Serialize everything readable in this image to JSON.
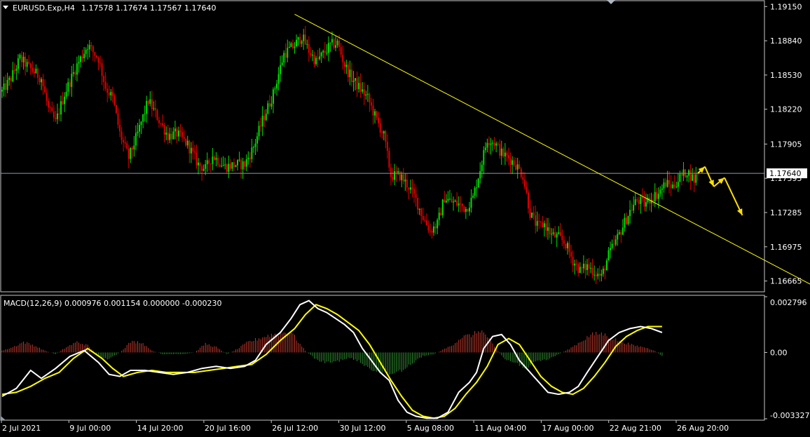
{
  "header": {
    "symbol_label": "EURUSD.Exp,H4",
    "ohlc_label": "1.17578 1.17674 1.17567 1.17640"
  },
  "colors": {
    "background": "#000000",
    "bull_candle": "#00e000",
    "bear_candle": "#e00000",
    "trendline": "#ffff00",
    "forecast_arrow": "#ffe000",
    "price_line": "#8a9bb0",
    "macd_line": "#ffffff",
    "signal_line": "#ffff00",
    "hist_positive": "#c0392b",
    "hist_negative": "#2e8b2e",
    "axis_text": "#ffffff",
    "price_tag_bg": "#ffffff",
    "price_tag_text": "#000000"
  },
  "chart_data": [
    {
      "type": "candlestick",
      "title": "EURUSD.Exp,H4",
      "y_ticks": [
        "1.19150",
        "1.18840",
        "1.18530",
        "1.18220",
        "1.17905",
        "1.17595",
        "1.17285",
        "1.16975",
        "1.16665"
      ],
      "ylim": [
        1.1658,
        1.1919
      ],
      "current_price": "1.17640",
      "x_ticks": [
        "2 Jul 2021",
        "9 Jul 00:00",
        "14 Jul 20:00",
        "20 Jul 16:00",
        "26 Jul 12:00",
        "30 Jul 12:00",
        "5 Aug 08:00",
        "11 Aug 04:00",
        "17 Aug 00:00",
        "22 Aug 21:00",
        "26 Aug 20:00"
      ],
      "close_path": [
        [
          0,
          1.1838
        ],
        [
          5,
          1.185
        ],
        [
          10,
          1.1868
        ],
        [
          15,
          1.186
        ],
        [
          22,
          1.185
        ],
        [
          26,
          1.1822
        ],
        [
          30,
          1.181
        ],
        [
          35,
          1.1836
        ],
        [
          42,
          1.1862
        ],
        [
          48,
          1.188
        ],
        [
          54,
          1.1868
        ],
        [
          58,
          1.1842
        ],
        [
          62,
          1.1832
        ],
        [
          66,
          1.18
        ],
        [
          71,
          1.1778
        ],
        [
          76,
          1.18
        ],
        [
          82,
          1.183
        ],
        [
          88,
          1.1812
        ],
        [
          93,
          1.1798
        ],
        [
          98,
          1.18
        ],
        [
          104,
          1.179
        ],
        [
          110,
          1.1772
        ],
        [
          114,
          1.1768
        ],
        [
          118,
          1.178
        ],
        [
          125,
          1.177
        ],
        [
          131,
          1.1772
        ],
        [
          136,
          1.1772
        ],
        [
          141,
          1.1788
        ],
        [
          146,
          1.1812
        ],
        [
          152,
          1.1836
        ],
        [
          158,
          1.1872
        ],
        [
          164,
          1.188
        ],
        [
          168,
          1.1888
        ],
        [
          172,
          1.1875
        ],
        [
          176,
          1.1865
        ],
        [
          180,
          1.1872
        ],
        [
          184,
          1.188
        ],
        [
          188,
          1.1882
        ],
        [
          192,
          1.1862
        ],
        [
          196,
          1.185
        ],
        [
          200,
          1.1842
        ],
        [
          205,
          1.1832
        ],
        [
          210,
          1.1812
        ],
        [
          214,
          1.1798
        ],
        [
          218,
          1.1762
        ],
        [
          223,
          1.1762
        ],
        [
          228,
          1.1752
        ],
        [
          232,
          1.174
        ],
        [
          236,
          1.1724
        ],
        [
          240,
          1.1712
        ],
        [
          244,
          1.1718
        ],
        [
          248,
          1.1742
        ],
        [
          252,
          1.1738
        ],
        [
          256,
          1.1736
        ],
        [
          260,
          1.1732
        ],
        [
          264,
          1.1742
        ],
        [
          268,
          1.1768
        ],
        [
          272,
          1.1795
        ],
        [
          276,
          1.1792
        ],
        [
          280,
          1.1782
        ],
        [
          284,
          1.1778
        ],
        [
          288,
          1.1772
        ],
        [
          292,
          1.1762
        ],
        [
          296,
          1.1728
        ],
        [
          300,
          1.1716
        ],
        [
          304,
          1.1718
        ],
        [
          308,
          1.1708
        ],
        [
          312,
          1.1706
        ],
        [
          316,
          1.17
        ],
        [
          320,
          1.1685
        ],
        [
          324,
          1.1676
        ],
        [
          328,
          1.168
        ],
        [
          332,
          1.1675
        ],
        [
          336,
          1.167
        ],
        [
          340,
          1.169
        ],
        [
          344,
          1.1702
        ],
        [
          348,
          1.1716
        ],
        [
          352,
          1.173
        ],
        [
          356,
          1.174
        ],
        [
          360,
          1.1736
        ],
        [
          364,
          1.1742
        ],
        [
          368,
          1.1746
        ],
        [
          372,
          1.1755
        ],
        [
          376,
          1.1752
        ],
        [
          380,
          1.176
        ],
        [
          384,
          1.1766
        ],
        [
          388,
          1.1758
        ],
        [
          390,
          1.1764
        ]
      ],
      "trendline": {
        "from": [
          164,
          1.1908
        ],
        "to": [
          455,
          1.1662
        ]
      },
      "forecast_path": [
        [
          390,
          1.1764
        ],
        [
          394,
          1.177
        ],
        [
          399,
          1.1752
        ],
        [
          405,
          1.176
        ],
        [
          415,
          1.1726
        ]
      ],
      "xlim": [
        0,
        427
      ]
    },
    {
      "type": "line",
      "title": "MACD(12,26,9) 0.000976 0.001154 0.000000 -0.000230",
      "y_ticks": [
        "0.002796",
        "0.00",
        "-0.003327"
      ],
      "ylim": [
        -0.003327,
        0.002796
      ],
      "series": [
        {
          "name": "MACD",
          "points": [
            [
              0,
              -0.0022
            ],
            [
              8,
              -0.0018
            ],
            [
              16,
              -0.0009
            ],
            [
              22,
              -0.0013
            ],
            [
              30,
              -0.0008
            ],
            [
              38,
              -0.0002
            ],
            [
              46,
              0.0001
            ],
            [
              54,
              -0.0005
            ],
            [
              60,
              -0.0011
            ],
            [
              66,
              -0.0012
            ],
            [
              72,
              -0.0009
            ],
            [
              80,
              -0.0009
            ],
            [
              88,
              -0.001
            ],
            [
              96,
              -0.0011
            ],
            [
              104,
              -0.001
            ],
            [
              112,
              -0.0008
            ],
            [
              120,
              -0.0007
            ],
            [
              128,
              -0.0008
            ],
            [
              136,
              -0.0007
            ],
            [
              142,
              -0.0004
            ],
            [
              148,
              0.0004
            ],
            [
              156,
              0.001
            ],
            [
              162,
              0.0017
            ],
            [
              167,
              0.0024
            ],
            [
              172,
              0.0026
            ],
            [
              177,
              0.0022
            ],
            [
              182,
              0.002
            ],
            [
              187,
              0.0017
            ],
            [
              192,
              0.0014
            ],
            [
              197,
              0.001
            ],
            [
              202,
              0.0002
            ],
            [
              207,
              -0.0004
            ],
            [
              212,
              -0.001
            ],
            [
              217,
              -0.0014
            ],
            [
              222,
              -0.0024
            ],
            [
              227,
              -0.003
            ],
            [
              232,
              -0.0032
            ],
            [
              238,
              -0.0033
            ],
            [
              244,
              -0.0033
            ],
            [
              250,
              -0.003
            ],
            [
              256,
              -0.002
            ],
            [
              262,
              -0.0015
            ],
            [
              266,
              -0.001
            ],
            [
              270,
              0.0002
            ],
            [
              275,
              0.0008
            ],
            [
              280,
              0.0009
            ],
            [
              285,
              0.0004
            ],
            [
              290,
              -0.0004
            ],
            [
              295,
              -0.0009
            ],
            [
              300,
              -0.0014
            ],
            [
              306,
              -0.002
            ],
            [
              312,
              -0.0021
            ],
            [
              318,
              -0.002
            ],
            [
              323,
              -0.0017
            ],
            [
              328,
              -0.001
            ],
            [
              334,
              -0.0002
            ],
            [
              340,
              0.0006
            ],
            [
              346,
              0.001
            ],
            [
              352,
              0.0012
            ],
            [
              358,
              0.0013
            ],
            [
              364,
              0.0012
            ],
            [
              370,
              0.001
            ]
          ]
        },
        {
          "name": "Signal",
          "points": [
            [
              0,
              -0.0021
            ],
            [
              8,
              -0.002
            ],
            [
              16,
              -0.0017
            ],
            [
              24,
              -0.0013
            ],
            [
              32,
              -0.001
            ],
            [
              40,
              -0.0003
            ],
            [
              48,
              0.0002
            ],
            [
              56,
              -0.0003
            ],
            [
              62,
              -0.0008
            ],
            [
              68,
              -0.0012
            ],
            [
              76,
              -0.001
            ],
            [
              84,
              -0.0009
            ],
            [
              92,
              -0.001
            ],
            [
              100,
              -0.001
            ],
            [
              108,
              -0.001
            ],
            [
              116,
              -0.0009
            ],
            [
              124,
              -0.0008
            ],
            [
              132,
              -0.0007
            ],
            [
              140,
              -0.0006
            ],
            [
              148,
              -0.0001
            ],
            [
              156,
              0.0006
            ],
            [
              164,
              0.0012
            ],
            [
              170,
              0.0019
            ],
            [
              176,
              0.0024
            ],
            [
              182,
              0.0022
            ],
            [
              188,
              0.0019
            ],
            [
              194,
              0.0015
            ],
            [
              200,
              0.0011
            ],
            [
              206,
              0.0004
            ],
            [
              212,
              -0.0005
            ],
            [
              218,
              -0.0014
            ],
            [
              224,
              -0.0022
            ],
            [
              230,
              -0.0029
            ],
            [
              236,
              -0.0032
            ],
            [
              242,
              -0.0033
            ],
            [
              248,
              -0.0032
            ],
            [
              254,
              -0.0028
            ],
            [
              260,
              -0.0021
            ],
            [
              266,
              -0.0015
            ],
            [
              272,
              -0.0007
            ],
            [
              278,
              0.0004
            ],
            [
              284,
              0.0007
            ],
            [
              290,
              0.0004
            ],
            [
              296,
              -0.0004
            ],
            [
              302,
              -0.0012
            ],
            [
              308,
              -0.0017
            ],
            [
              314,
              -0.002
            ],
            [
              320,
              -0.0021
            ],
            [
              326,
              -0.0018
            ],
            [
              332,
              -0.0012
            ],
            [
              338,
              -0.0005
            ],
            [
              344,
              0.0003
            ],
            [
              350,
              0.0008
            ],
            [
              356,
              0.0011
            ],
            [
              362,
              0.0013
            ],
            [
              368,
              0.0013
            ],
            [
              370,
              0.0013
            ]
          ]
        }
      ],
      "histogram_envelope": [
        [
          0,
          0.0001
        ],
        [
          6,
          0.0003
        ],
        [
          12,
          0.0006
        ],
        [
          18,
          0.0004
        ],
        [
          24,
          0.0001
        ],
        [
          30,
          -0.0001
        ],
        [
          36,
          0.0003
        ],
        [
          42,
          0.0006
        ],
        [
          48,
          0.0004
        ],
        [
          54,
          -0.0002
        ],
        [
          60,
          -0.0004
        ],
        [
          66,
          0.0
        ],
        [
          72,
          0.0006
        ],
        [
          78,
          0.0006
        ],
        [
          84,
          0.0001
        ],
        [
          90,
          -0.0001
        ],
        [
          96,
          -0.0001
        ],
        [
          102,
          -0.0001
        ],
        [
          108,
          0.0
        ],
        [
          114,
          0.0005
        ],
        [
          120,
          0.0003
        ],
        [
          126,
          -0.0001
        ],
        [
          132,
          0.0002
        ],
        [
          138,
          0.0006
        ],
        [
          144,
          0.0008
        ],
        [
          150,
          0.001
        ],
        [
          156,
          0.0011
        ],
        [
          162,
          0.0012
        ],
        [
          166,
          0.0006
        ],
        [
          170,
          0.0001
        ],
        [
          176,
          -0.0004
        ],
        [
          182,
          -0.0006
        ],
        [
          188,
          -0.0005
        ],
        [
          194,
          -0.0003
        ],
        [
          200,
          -0.0005
        ],
        [
          206,
          -0.0009
        ],
        [
          212,
          -0.0011
        ],
        [
          218,
          -0.0012
        ],
        [
          224,
          -0.001
        ],
        [
          230,
          -0.0006
        ],
        [
          236,
          -0.0002
        ],
        [
          242,
          -0.0001
        ],
        [
          246,
          0.0001
        ],
        [
          252,
          0.0004
        ],
        [
          258,
          0.0009
        ],
        [
          264,
          0.001
        ],
        [
          268,
          0.0013
        ],
        [
          272,
          0.0009
        ],
        [
          276,
          0.0003
        ],
        [
          282,
          -0.0004
        ],
        [
          288,
          -0.0006
        ],
        [
          294,
          -0.0009
        ],
        [
          300,
          -0.0005
        ],
        [
          306,
          -0.0004
        ],
        [
          312,
          -0.0001
        ],
        [
          318,
          0.0002
        ],
        [
          324,
          0.0006
        ],
        [
          330,
          0.001
        ],
        [
          336,
          0.0011
        ],
        [
          342,
          0.0008
        ],
        [
          348,
          0.0006
        ],
        [
          354,
          0.0004
        ],
        [
          360,
          0.0003
        ],
        [
          366,
          0.0001
        ],
        [
          370,
          -0.0002
        ]
      ],
      "xlim": [
        0,
        427
      ]
    }
  ]
}
